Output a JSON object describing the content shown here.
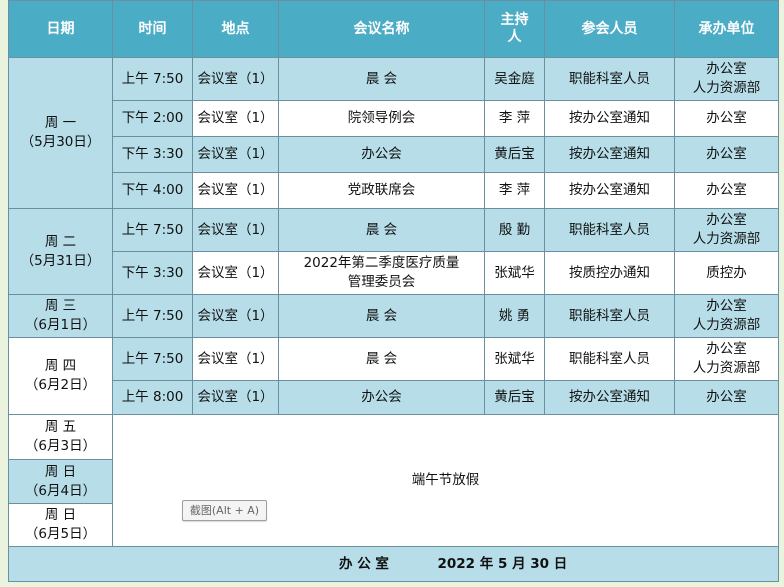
{
  "headers": {
    "date": "日期",
    "time": "时间",
    "location": "地点",
    "name": "会议名称",
    "host": "主持人",
    "attendees": "参会人员",
    "unit": "承办单位"
  },
  "days": [
    {
      "day": "周 一",
      "date": "（5月30日）"
    },
    {
      "day": "周 二",
      "date": "（5月31日）"
    },
    {
      "day": "周 三",
      "date": "（6月1日）"
    },
    {
      "day": "周 四",
      "date": "（6月2日）"
    },
    {
      "day": "周 五",
      "date": "（6月3日）"
    },
    {
      "day": "周 日",
      "date": "（6月4日）"
    },
    {
      "day": "周 日",
      "date": "（6月5日）"
    }
  ],
  "meetings": [
    {
      "time": "上午 7:50",
      "location": "会议室（1）",
      "name": "晨 会",
      "host": "吴金庭",
      "attendees": "职能科室人员",
      "unit": "办公室\n人力资源部"
    },
    {
      "time": "下午 2:00",
      "location": "会议室（1）",
      "name": "院领导例会",
      "host": "李 萍",
      "attendees": "按办公室通知",
      "unit": "办公室"
    },
    {
      "time": "下午 3:30",
      "location": "会议室（1）",
      "name": "办公会",
      "host": "黄后宝",
      "attendees": "按办公室通知",
      "unit": "办公室"
    },
    {
      "time": "下午 4:00",
      "location": "会议室（1）",
      "name": "党政联席会",
      "host": "李 萍",
      "attendees": "按办公室通知",
      "unit": "办公室"
    },
    {
      "time": "上午 7:50",
      "location": "会议室（1）",
      "name": "晨 会",
      "host": "殷 勤",
      "attendees": "职能科室人员",
      "unit": "办公室\n人力资源部"
    },
    {
      "time": "下午 3:30",
      "location": "会议室（1）",
      "name": "2022年第二季度医疗质量\n管理委员会",
      "host": "张斌华",
      "attendees": "按质控办通知",
      "unit": "质控办"
    },
    {
      "time": "上午 7:50",
      "location": "会议室（1）",
      "name": "晨 会",
      "host": "姚 勇",
      "attendees": "职能科室人员",
      "unit": "办公室\n人力资源部"
    },
    {
      "time": "上午 7:50",
      "location": "会议室（1）",
      "name": "晨 会",
      "host": "张斌华",
      "attendees": "职能科室人员",
      "unit": "办公室\n人力资源部"
    },
    {
      "time": "上午 8:00",
      "location": "会议室（1）",
      "name": "办公会",
      "host": "黄后宝",
      "attendees": "按办公室通知",
      "unit": "办公室"
    }
  ],
  "holiday": "端午节放假",
  "footer": {
    "office": "办 公 室",
    "date": "2022 年 5 月 30 日"
  },
  "screenshot_button": "截图(Alt + A)",
  "colors": {
    "header": "#4bacc6",
    "highlight": "#b6dde8",
    "body": "#ffffff",
    "border": "#6a8fa0"
  }
}
